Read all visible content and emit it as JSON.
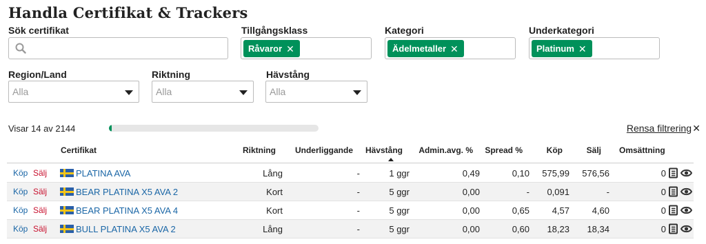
{
  "page": {
    "title": "Handla Certifikat & Trackers"
  },
  "filters": {
    "search": {
      "label": "Sök certifikat",
      "value": "",
      "placeholder": ""
    },
    "asset_class": {
      "label": "Tillgångsklass",
      "tag": "Råvaror"
    },
    "category": {
      "label": "Kategori",
      "tag": "Ädelmetaller"
    },
    "subcategory": {
      "label": "Underkategori",
      "tag": "Platinum"
    },
    "region": {
      "label": "Region/Land",
      "value": "Alla"
    },
    "direction": {
      "label": "Riktning",
      "value": "Alla"
    },
    "leverage": {
      "label": "Hävstång",
      "value": "Alla"
    }
  },
  "results": {
    "showing": "Visar 14 av 2144",
    "progress_fraction": 0.0065,
    "clear_label": "Rensa filtrering"
  },
  "table": {
    "headers": {
      "certifikat": "Certifikat",
      "riktning": "Riktning",
      "underliggande": "Underliggande",
      "havstang": "Hävstång",
      "admin": "Admin.avg. %",
      "spread": "Spread %",
      "kop": "Köp",
      "salj": "Sälj",
      "omsattning": "Omsättning"
    },
    "buy_label": "Köp",
    "sell_label": "Sälj",
    "rows": [
      {
        "name": "PLATINA AVA",
        "riktning": "Lång",
        "underliggande": "-",
        "havstang": "1 ggr",
        "admin": "0,49",
        "spread": "0,10",
        "kop": "575,99",
        "salj": "576,56",
        "omsattning": "0"
      },
      {
        "name": "BEAR PLATINA X5 AVA 2",
        "riktning": "Kort",
        "underliggande": "-",
        "havstang": "5 ggr",
        "admin": "0,00",
        "spread": "-",
        "kop": "0,091",
        "salj": "-",
        "omsattning": "0"
      },
      {
        "name": "BEAR PLATINA X5 AVA 4",
        "riktning": "Kort",
        "underliggande": "-",
        "havstang": "5 ggr",
        "admin": "0,00",
        "spread": "0,65",
        "kop": "4,57",
        "salj": "4,60",
        "omsattning": "0"
      },
      {
        "name": "BULL PLATINA X5 AVA 2",
        "riktning": "Lång",
        "underliggande": "-",
        "havstang": "5 ggr",
        "admin": "0,00",
        "spread": "0,60",
        "kop": "18,23",
        "salj": "18,34",
        "omsattning": "0"
      }
    ]
  },
  "icons": {
    "search": "search-icon",
    "remove": "close-icon",
    "caret": "caret-down-icon",
    "info": "document-icon",
    "watch": "eye-icon",
    "flag": "swedish-flag-icon"
  },
  "colors": {
    "accent": "#00915a",
    "link": "#1a66a6",
    "sell": "#c8102e"
  }
}
